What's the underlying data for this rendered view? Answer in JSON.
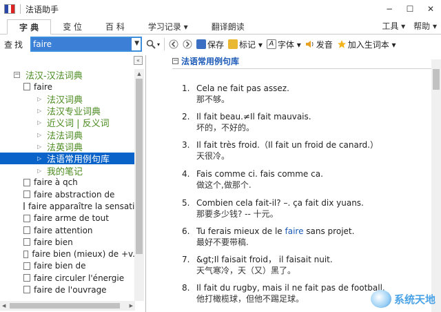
{
  "window": {
    "title": "法语助手",
    "min": "−",
    "max": "☐",
    "close": "✕"
  },
  "tabs": [
    {
      "label": "字 典"
    },
    {
      "label": "变 位"
    },
    {
      "label": "百 科"
    },
    {
      "label": "学习记录 ▾"
    },
    {
      "label": "翻译朗读"
    }
  ],
  "menu_right": {
    "tools": "工具 ▾",
    "help": "帮助 ▾"
  },
  "search": {
    "label": "查找",
    "value": "faire"
  },
  "toolbar": {
    "save": "保存",
    "bookmark": "标记 ▾",
    "font": "字体 ▾",
    "speak": "发音",
    "add_vocab": "加入生词本 ▾"
  },
  "colors": {
    "accent": "#1a58b8",
    "selection": "#0a63c9",
    "tree_text": "#4a8a1e"
  },
  "tree": {
    "root": "法汉-汉法词典",
    "headword": "faire",
    "sections": [
      "法汉词典",
      "法汉专业词典",
      "近义词 | 反义词",
      "法法词典",
      "法英词典",
      "法语常用例句库",
      "我的笔记"
    ],
    "selected_index": 5,
    "words": [
      "faire à qch",
      "faire abstraction de",
      "faire apparaître la sensation",
      "faire arme de tout",
      "faire attention",
      "faire bien",
      "faire bien (mieux) de +v.",
      "faire bien de",
      "faire circuler l'énergie",
      "faire de l'ouvrage"
    ]
  },
  "content": {
    "section_title": "法语常用例句库",
    "examples": [
      {
        "num": "1.",
        "fr_before": "Cela ne fait pas assez.",
        "fr_hl": "",
        "fr_after": "",
        "zh": "那不够。"
      },
      {
        "num": "2.",
        "fr_before": "Il fait beau.≠Il fait mauvais.",
        "fr_hl": "",
        "fr_after": "",
        "zh": "坏的，不好的。"
      },
      {
        "num": "3.",
        "fr_before": "Il fait très froid.（Il fait un froid de canard.）",
        "fr_hl": "",
        "fr_after": "",
        "zh": "天很冷。"
      },
      {
        "num": "4.",
        "fr_before": "Fais comme ci. fais comme ca.",
        "fr_hl": "",
        "fr_after": "",
        "zh": "做这个,做那个."
      },
      {
        "num": "5.",
        "fr_before": "Combien cela fait-il? –. ça fait dix yuans.",
        "fr_hl": "",
        "fr_after": "",
        "zh": "那要多少钱? -- 十元。"
      },
      {
        "num": "6.",
        "fr_before": "Tu ferais mieux de le ",
        "fr_hl": "faire",
        "fr_after": " sans projet.",
        "zh": "最好不要带稿."
      },
      {
        "num": "7.",
        "fr_before": "&gt;Il faisait froid，  il faisait nuit.",
        "fr_hl": "",
        "fr_after": "",
        "zh": "天气寒冷，天（又）黑了。"
      },
      {
        "num": "8.",
        "fr_before": "Il fait du rugby, mais il ne fait pas de football.",
        "fr_hl": "",
        "fr_after": "",
        "zh": "他打橄榄球，但他不踢足球。"
      }
    ]
  },
  "watermark": "系统天地"
}
